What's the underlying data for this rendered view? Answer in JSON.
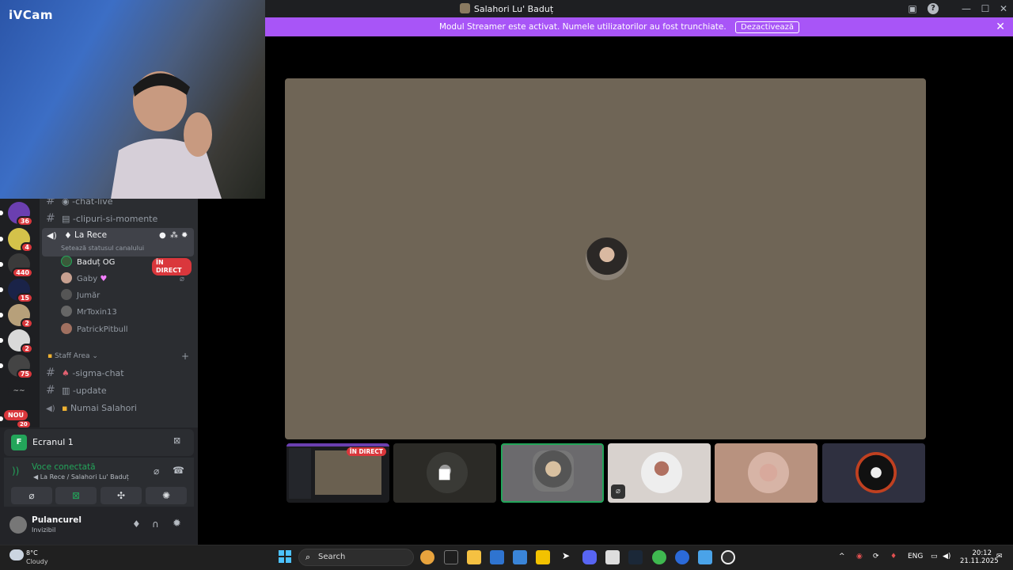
{
  "window": {
    "title": "Salahori Lu' Baduț"
  },
  "banner": {
    "text": "Modul Streamer este activat. Numele utilizatorilor au fost trunchiate.",
    "button": "Dezactivează"
  },
  "webcam": {
    "label": "iVCam"
  },
  "servers": [
    {
      "badge": "36",
      "color": "#6b3fb0"
    },
    {
      "badge": "4",
      "color": "#d4c24a"
    },
    {
      "badge": "440",
      "color": "#3a3a3a"
    },
    {
      "badge": "15",
      "color": "#1a2348"
    },
    {
      "badge": "2",
      "color": "#b7a07a"
    },
    {
      "badge": "2",
      "color": "#d9d9d9"
    },
    {
      "badge": "75",
      "color": "#444"
    },
    {
      "badge": "",
      "color": "#1e1f22"
    }
  ],
  "new_badge": "NOU",
  "partial_badge": "20",
  "channels": {
    "chat_live": "-chat-live",
    "clipuri": "-clipuri-si-momente",
    "voice_name": "La Rece",
    "voice_status": "Setează statusul canalului",
    "users": [
      {
        "name": "Baduț OG",
        "live": "ÎN DIRECT",
        "color": "#3a5a3a"
      },
      {
        "name": "Gaby",
        "color": "#c7a090"
      },
      {
        "name": "Jumăr",
        "color": "#555"
      },
      {
        "name": "MrToxin13",
        "color": "#666"
      },
      {
        "name": "PatrickPitbull",
        "color": "#a07060"
      }
    ],
    "category": "Staff Area",
    "sigma": "-sigma-chat",
    "update": "-update",
    "numai": "Numai Salahori"
  },
  "panel": {
    "screen_title": "Ecranul 1",
    "voice_status": "Voce conectată",
    "voice_location": "La Rece / Salahori Lu' Baduț",
    "username": "Pulancurel",
    "user_status": "Invizibil"
  },
  "tiles": [
    {
      "live": "ÎN DIRECT"
    }
  ],
  "taskbar": {
    "weather_temp": "8°C",
    "weather_desc": "Cloudy",
    "search": "Search",
    "lang": "ENG",
    "time": "20:12",
    "date": "21.11.2025"
  },
  "colors": {
    "accent": "#a855f7",
    "stage": "#6f6556",
    "live": "#da373c",
    "connected": "#23a55a"
  }
}
